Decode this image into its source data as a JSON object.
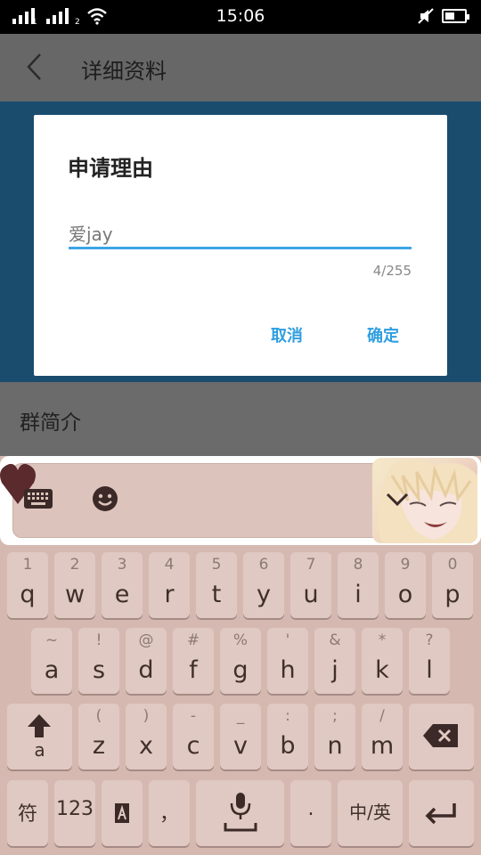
{
  "status_bar": {
    "time": "15:06",
    "sim1": "1",
    "sim2": "2",
    "icons": [
      "signal-icon",
      "signal-icon",
      "wifi-icon",
      "mute-icon",
      "battery-icon"
    ],
    "battery_level": 0.5
  },
  "header": {
    "title": "详细资料",
    "back_icon": "back-arrow-icon"
  },
  "page": {
    "group_intro_label": "群简介"
  },
  "dialog": {
    "title": "申请理由",
    "input_value": "爱jay",
    "char_count": "4/255",
    "cancel_label": "取消",
    "confirm_label": "确定",
    "accent": "#2f9ee0"
  },
  "keyboard": {
    "toolbar_icons": [
      "keyboard-icon",
      "emoji-icon",
      "chevron-down-icon"
    ],
    "row1": [
      {
        "hint": "1",
        "key": "q"
      },
      {
        "hint": "2",
        "key": "w"
      },
      {
        "hint": "3",
        "key": "e"
      },
      {
        "hint": "4",
        "key": "r"
      },
      {
        "hint": "5",
        "key": "t"
      },
      {
        "hint": "6",
        "key": "y"
      },
      {
        "hint": "7",
        "key": "u"
      },
      {
        "hint": "8",
        "key": "i"
      },
      {
        "hint": "9",
        "key": "o"
      },
      {
        "hint": "0",
        "key": "p"
      }
    ],
    "row2": [
      {
        "hint": "~",
        "key": "a"
      },
      {
        "hint": "!",
        "key": "s"
      },
      {
        "hint": "@",
        "key": "d"
      },
      {
        "hint": "#",
        "key": "f"
      },
      {
        "hint": "%",
        "key": "g"
      },
      {
        "hint": "'",
        "key": "h"
      },
      {
        "hint": "&",
        "key": "j"
      },
      {
        "hint": "*",
        "key": "k"
      },
      {
        "hint": "?",
        "key": "l"
      }
    ],
    "row3": [
      {
        "hint": "(",
        "key": "z"
      },
      {
        "hint": ")",
        "key": "x"
      },
      {
        "hint": "-",
        "key": "c"
      },
      {
        "hint": "_",
        "key": "v"
      },
      {
        "hint": ":",
        "key": "b"
      },
      {
        "hint": ";",
        "key": "n"
      },
      {
        "hint": "/",
        "key": "m"
      }
    ],
    "shift_label": "a",
    "symbols_label": "符",
    "numbers_label": "123",
    "comma_label": "，",
    "period_label": ".",
    "lang_label": "中/英",
    "colors": {
      "key_bg": "#e0c9c2",
      "keyboard_bg": "#d5b9b1"
    }
  }
}
